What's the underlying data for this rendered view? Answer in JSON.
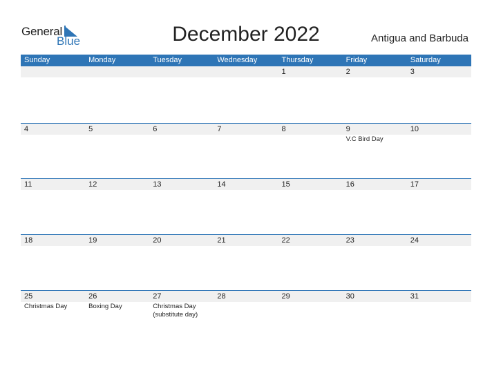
{
  "logo": {
    "general": "General",
    "blue": "Blue"
  },
  "title": "December 2022",
  "country": "Antigua and Barbuda",
  "colors": {
    "accent": "#2e75b6",
    "date_row_bg": "#f0f0f0"
  },
  "weekdays": [
    "Sunday",
    "Monday",
    "Tuesday",
    "Wednesday",
    "Thursday",
    "Friday",
    "Saturday"
  ],
  "weeks": [
    {
      "days": [
        "",
        "",
        "",
        "",
        "1",
        "2",
        "3"
      ],
      "holidays": [
        "",
        "",
        "",
        "",
        "",
        "",
        ""
      ]
    },
    {
      "days": [
        "4",
        "5",
        "6",
        "7",
        "8",
        "9",
        "10"
      ],
      "holidays": [
        "",
        "",
        "",
        "",
        "",
        "V.C Bird Day",
        ""
      ]
    },
    {
      "days": [
        "11",
        "12",
        "13",
        "14",
        "15",
        "16",
        "17"
      ],
      "holidays": [
        "",
        "",
        "",
        "",
        "",
        "",
        ""
      ]
    },
    {
      "days": [
        "18",
        "19",
        "20",
        "21",
        "22",
        "23",
        "24"
      ],
      "holidays": [
        "",
        "",
        "",
        "",
        "",
        "",
        ""
      ]
    },
    {
      "days": [
        "25",
        "26",
        "27",
        "28",
        "29",
        "30",
        "31"
      ],
      "holidays": [
        "Christmas Day",
        "Boxing Day",
        "Christmas Day (substitute day)",
        "",
        "",
        "",
        ""
      ]
    }
  ]
}
